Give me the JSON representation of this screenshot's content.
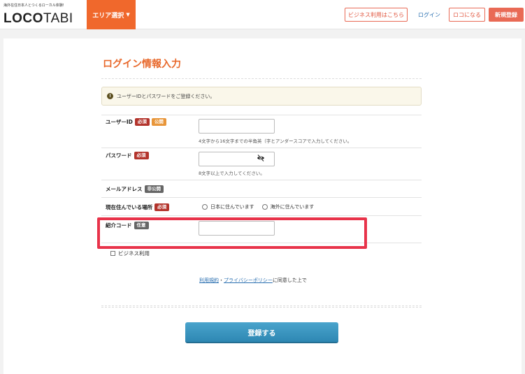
{
  "header": {
    "tagline": "海外在住日本人とつくるローカル体験!",
    "logo_bold": "LOCO",
    "logo_light": "TABI",
    "area_select": "エリア選択",
    "business_btn": "ビジネス利用はこちら",
    "login": "ログイン",
    "become_loco": "ロコになる",
    "signup": "新規登録",
    "accent_color": "#f0682c"
  },
  "form": {
    "title": "ログイン情報入力",
    "notice": "ユーザーIDとパスワードをご登録ください。",
    "user_id": {
      "label": "ユーザーID",
      "badge_required": "必須",
      "badge_public": "公開",
      "value": "",
      "hint": "4文字から16文字までの半角英（字とアンダースコアで入力してください。"
    },
    "password": {
      "label": "パスワード",
      "badge_required": "必須",
      "value": "",
      "hint": "8文字以上で入力してください。"
    },
    "email": {
      "label": "メールアドレス",
      "badge_private": "非公開"
    },
    "residence": {
      "label": "現在住んでいる場所",
      "badge_required": "必須",
      "options": [
        "日本に住んでいます",
        "海外に住んでいます"
      ]
    },
    "referral": {
      "label": "紹介コード",
      "badge_optional": "任意",
      "value": ""
    },
    "business_use": "ビジネス利用",
    "agree": {
      "terms": "利用規約",
      "sep": "・",
      "privacy": "プライバシーポリシー",
      "suffix": "に同意した上で"
    },
    "submit": "登録する"
  }
}
